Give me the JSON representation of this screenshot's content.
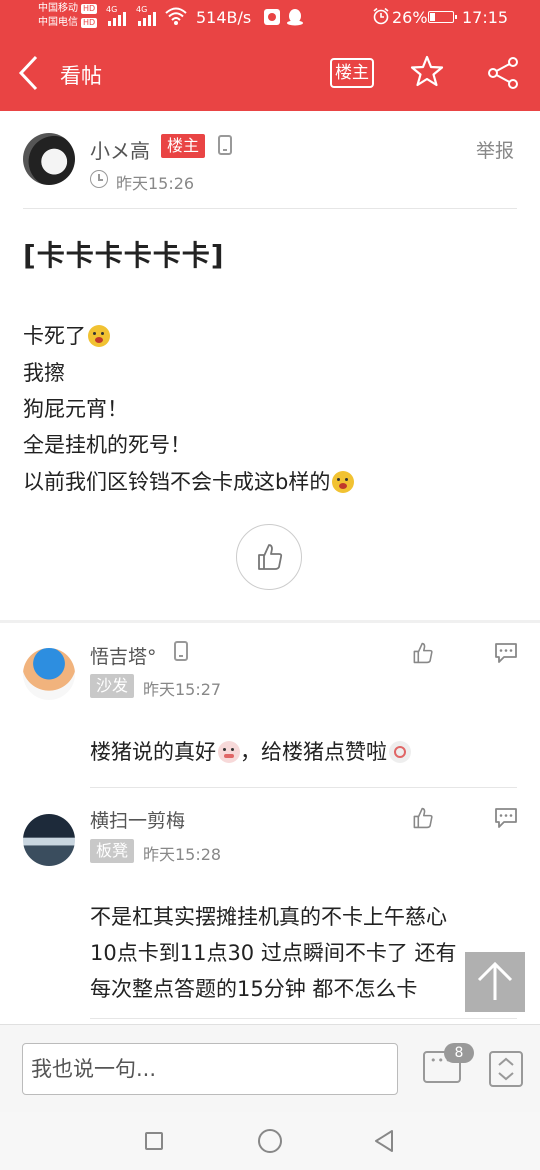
{
  "status_bar": {
    "carrier1": "中国移动",
    "carrier2": "中国电信",
    "hd_label": "HD",
    "net1": "4G",
    "net2": "4G",
    "speed": "514B/s",
    "battery": "26%",
    "battery_level": 0.26,
    "time": "17:15"
  },
  "nav": {
    "title": "看帖",
    "op_only_label": "楼主"
  },
  "post": {
    "author": "小メ高",
    "op_tag": "楼主",
    "time": "昨天15:26",
    "report_label": "举报",
    "title": "[卡卡卡卡卡卡]",
    "lines": [
      "卡死了",
      "我擦",
      "狗屁元宵！",
      "全是挂机的死号！",
      "以前我们区铃铛不会卡成这b样的"
    ]
  },
  "replies": [
    {
      "author": "悟吉塔°",
      "floor": "沙发",
      "time": "昨天15:27",
      "text_a": "楼猪说的真好",
      "text_b": "，给楼猪点赞啦"
    },
    {
      "author": "横扫一剪梅",
      "floor": "板凳",
      "time": "昨天15:28",
      "lines": [
        "不是杠其实摆摊挂机真的不卡上午慈心",
        "10点卡到11点30   过点瞬间不卡了  还有",
        "每次整点答题的15分钟 都不怎么卡"
      ]
    }
  ],
  "bottom": {
    "input_placeholder": "我也说一句...",
    "comment_count": "8"
  }
}
